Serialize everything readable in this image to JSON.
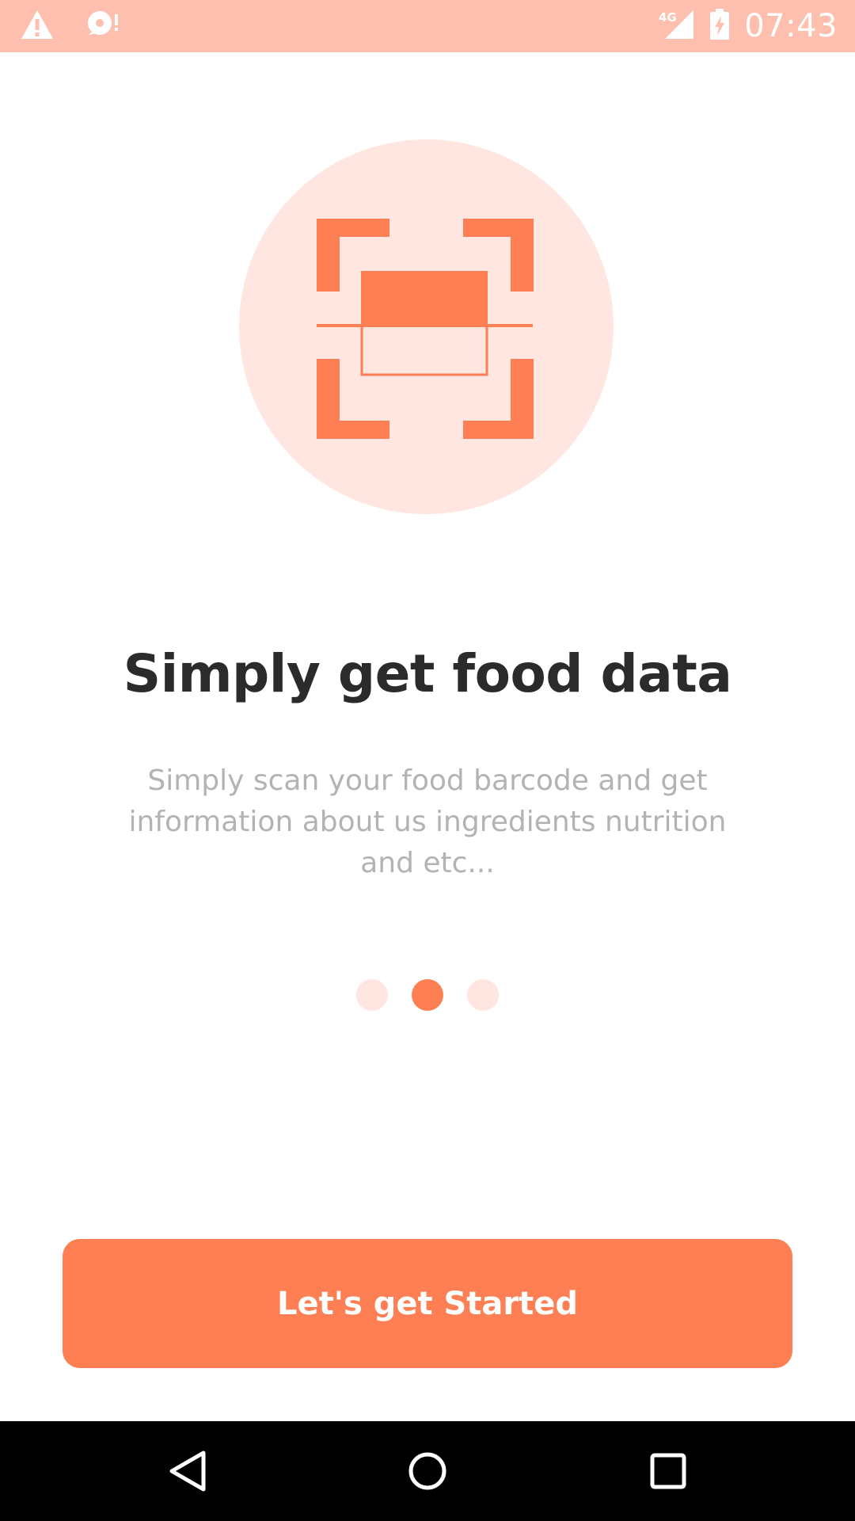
{
  "status_bar": {
    "time": "07:43",
    "network_label": "4G",
    "icons": [
      "warning-icon",
      "notification-icon",
      "signal-icon",
      "battery-charging-icon"
    ]
  },
  "onboarding": {
    "illustration_icon": "barcode-scanner-icon",
    "title": "Simply get food data",
    "description": "Simply scan your food barcode and get information about us ingredients nutrition and etc...",
    "page_count": 3,
    "active_page": 2
  },
  "cta": {
    "label": "Let's get Started"
  },
  "navigation_bar": {
    "icons": [
      "back-icon",
      "home-icon",
      "recents-icon"
    ]
  },
  "colors": {
    "accent": "#ff7f55",
    "accent_light": "#ffe6e0",
    "status_bar": "#ffbfaf",
    "title": "#2b2b2b",
    "body_text": "#b3b3b3",
    "nav_bar": "#000000"
  }
}
